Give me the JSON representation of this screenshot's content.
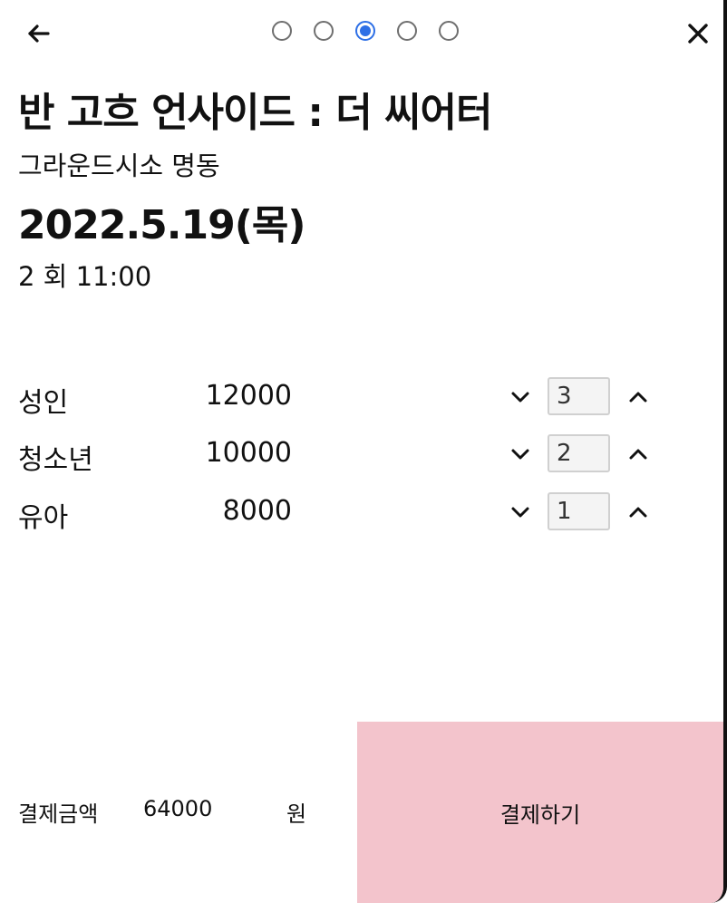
{
  "colors": {
    "accent": "#2d6fe6",
    "pay_button_bg": "#f3c4cc"
  },
  "nav": {
    "back_icon": "arrow-left-icon",
    "close_icon": "close-x-icon",
    "steps": [
      {
        "active": false
      },
      {
        "active": false
      },
      {
        "active": true
      },
      {
        "active": false
      },
      {
        "active": false
      }
    ]
  },
  "show": {
    "title": "반 고흐 언사이드 : 더 씨어터",
    "venue": "그라운드시소 명동",
    "date": "2022.5.19(목)",
    "session": "2 회 11:00"
  },
  "tickets": [
    {
      "label": "성인",
      "price": "12000",
      "quantity": "3"
    },
    {
      "label": "청소년",
      "price": "10000",
      "quantity": "2"
    },
    {
      "label": "유아",
      "price": "8000",
      "quantity": "1"
    }
  ],
  "footer": {
    "label": "결제금액",
    "amount": "64000",
    "unit": "원",
    "pay_label": "결제하기"
  }
}
